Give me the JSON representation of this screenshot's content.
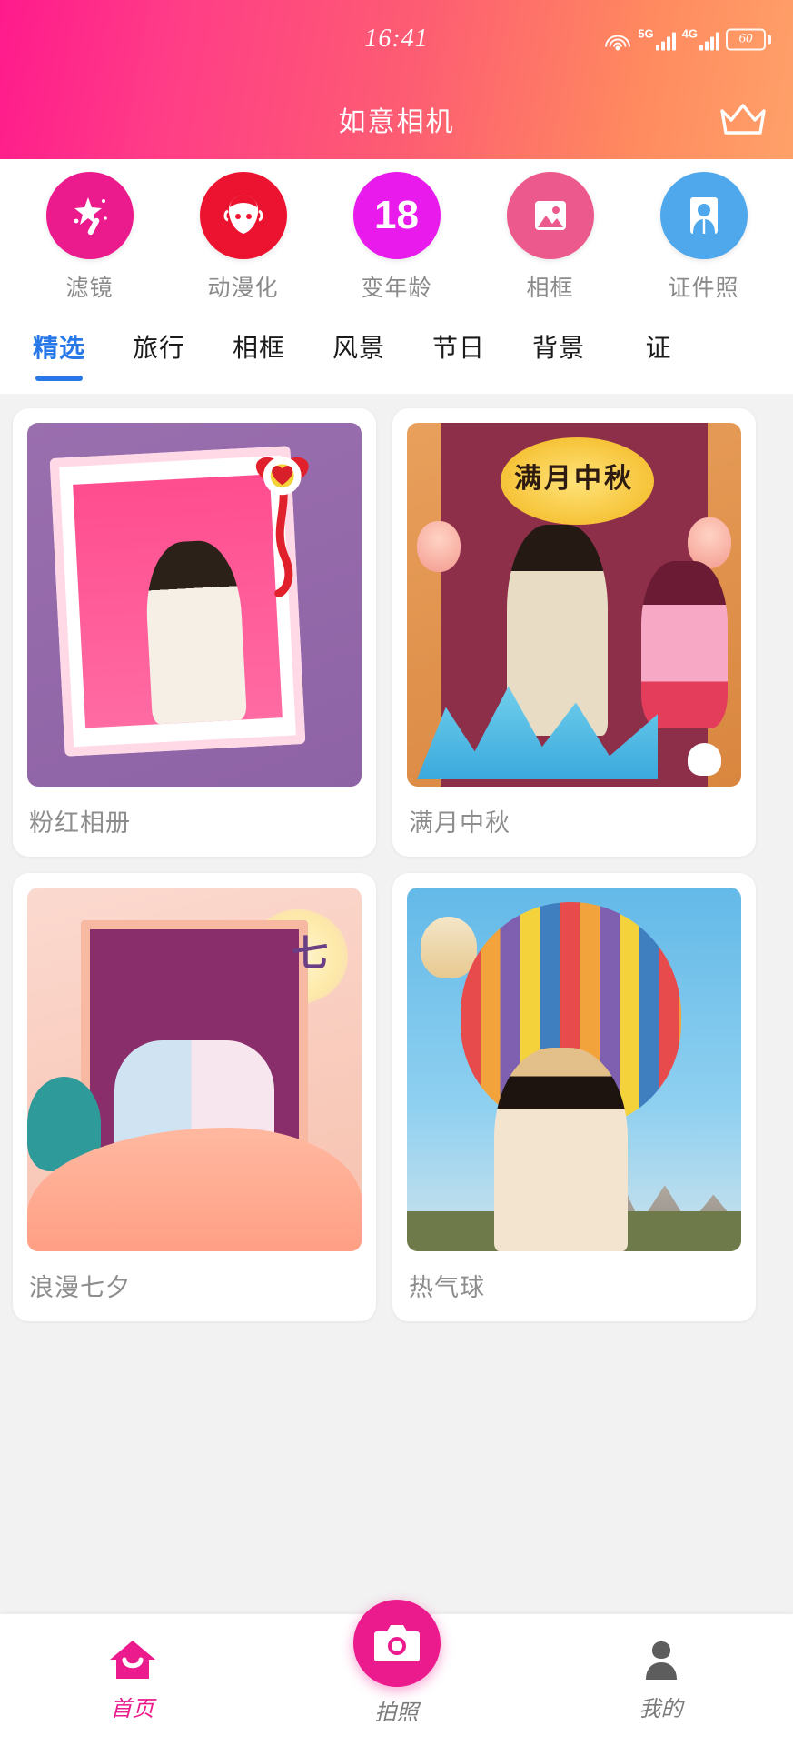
{
  "status_bar": {
    "time": "16:41",
    "wifi_icon": "wifi-icon",
    "sim1_label": "5G",
    "sim2_label": "4G",
    "battery_level": "60"
  },
  "header": {
    "title": "如意相机",
    "vip_icon": "crown-icon",
    "gradient_from": "#ff1a8c",
    "gradient_to": "#ffa169"
  },
  "quick_actions": [
    {
      "label": "滤镜",
      "icon": "magic-wand-icon",
      "color": "#ec1b8d"
    },
    {
      "label": "动漫化",
      "icon": "face-anime-icon",
      "color": "#ec1330"
    },
    {
      "label": "变年龄",
      "icon": "age-18-icon",
      "color": "#e81bec",
      "badge": "18"
    },
    {
      "label": "相框",
      "icon": "photo-frame-icon",
      "color": "#ec5a8d"
    },
    {
      "label": "证件照",
      "icon": "id-photo-icon",
      "color": "#4fa8ec"
    }
  ],
  "category_tabs": {
    "active_index": 0,
    "active_color": "#2878e8",
    "items": [
      "精选",
      "旅行",
      "相框",
      "风景",
      "节日",
      "背景",
      "证"
    ]
  },
  "template_cards": [
    {
      "title": "粉红相册",
      "art": "a1"
    },
    {
      "title": "满月中秋",
      "art": "a2",
      "art_text": "满月中秋"
    },
    {
      "title": "浪漫七夕",
      "art": "a3",
      "art_text": "七"
    },
    {
      "title": "热气球",
      "art": "a4"
    }
  ],
  "bottom_nav": {
    "active_index": 0,
    "active_color": "#ec1b8d",
    "items": [
      {
        "label": "首页",
        "icon": "home-icon"
      },
      {
        "label": "拍照",
        "icon": "camera-icon"
      },
      {
        "label": "我的",
        "icon": "person-icon"
      }
    ]
  }
}
